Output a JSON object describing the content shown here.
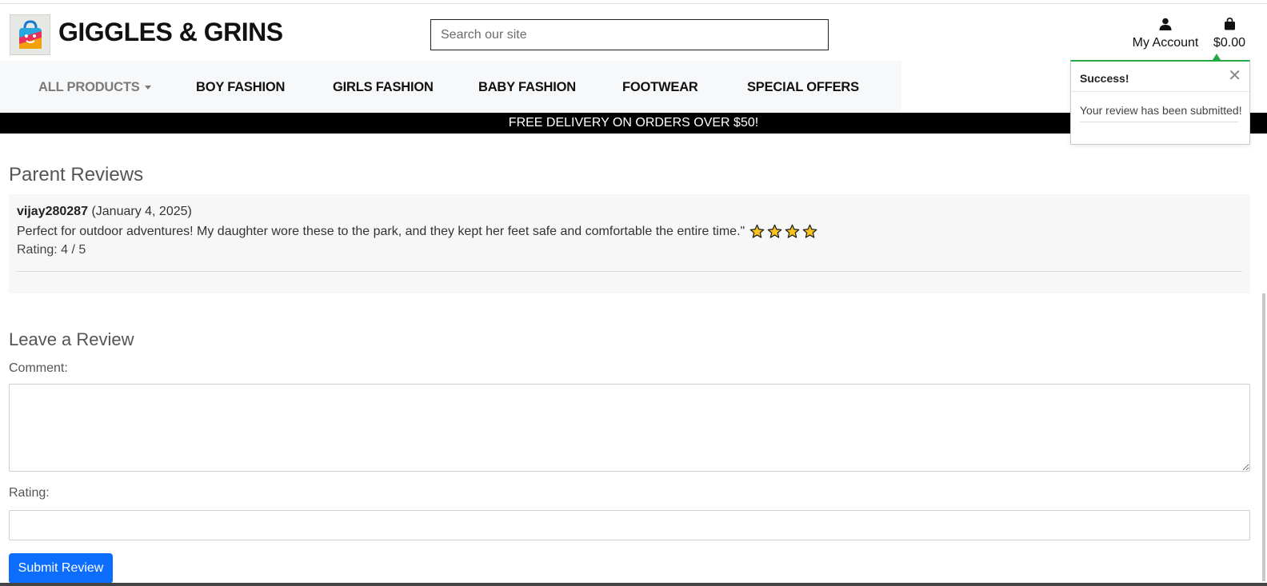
{
  "header": {
    "brand": "GIGGLES & GRINS",
    "search_placeholder": "Search our site",
    "account_label": "My Account",
    "cart_total": "$0.00"
  },
  "nav": {
    "items": [
      {
        "label": "ALL PRODUCTS"
      },
      {
        "label": "BOY FASHION"
      },
      {
        "label": "GIRLS FASHION"
      },
      {
        "label": "BABY FASHION"
      },
      {
        "label": "FOOTWEAR"
      },
      {
        "label": "SPECIAL OFFERS"
      }
    ]
  },
  "banner": {
    "text": "FREE DELIVERY ON ORDERS OVER $50!"
  },
  "toast": {
    "title": "Success!",
    "close_glyph": "✕",
    "message": "Your review has been submitted!",
    "accent_color": "#28a745"
  },
  "reviews": {
    "title": "Parent Reviews",
    "items": [
      {
        "username": "vijay280287",
        "date": "(January 4, 2025)",
        "text": "Perfect for outdoor adventures! My daughter wore these to the park, and they kept her feet safe and comfortable the entire time.\"",
        "rating_text": "Rating: 4 / 5",
        "stars": 4
      }
    ]
  },
  "review_form": {
    "title": "Leave a Review",
    "comment_label": "Comment:",
    "comment_value": "",
    "rating_label": "Rating:",
    "rating_value": "",
    "submit_label": "Submit Review",
    "submit_color": "#0d6efd"
  }
}
